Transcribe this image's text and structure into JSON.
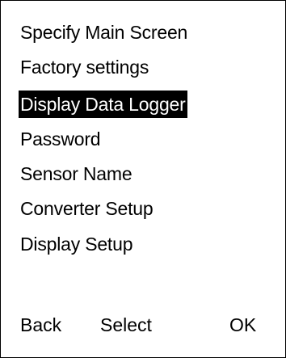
{
  "menu": {
    "items": [
      {
        "label": "Specify Main Screen",
        "selected": false
      },
      {
        "label": "Factory settings",
        "selected": false
      },
      {
        "label": "Display Data Logger",
        "selected": true
      },
      {
        "label": "Password",
        "selected": false
      },
      {
        "label": "Sensor Name",
        "selected": false
      },
      {
        "label": "Converter Setup",
        "selected": false
      },
      {
        "label": "Display Setup",
        "selected": false
      }
    ]
  },
  "softkeys": {
    "back_label": "Back",
    "select_label": "Select",
    "ok_label": "OK"
  },
  "colors": {
    "background": "#ffffff",
    "text": "#000000",
    "highlight_background": "#000000",
    "highlight_text": "#ffffff"
  }
}
